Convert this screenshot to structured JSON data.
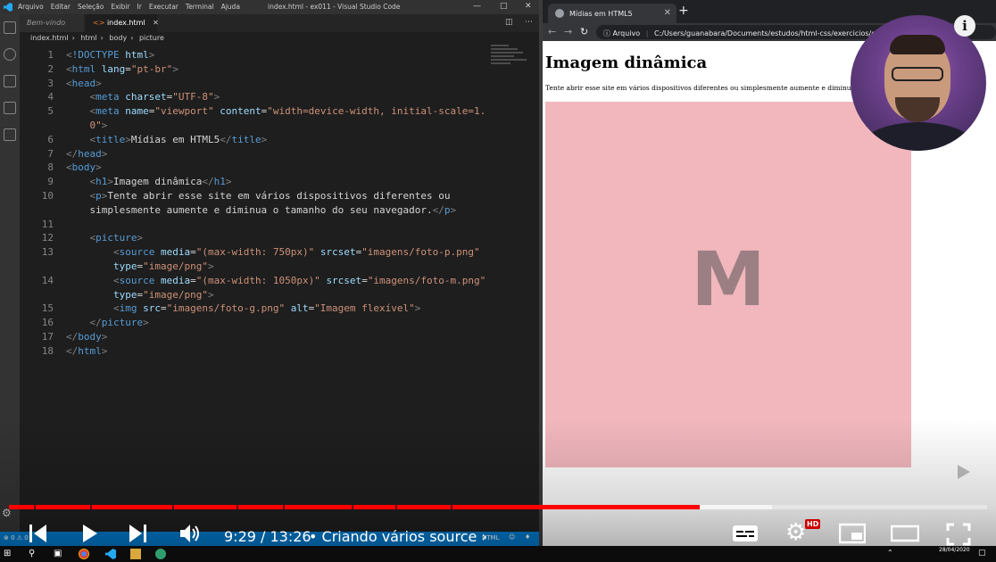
{
  "vscode": {
    "menu": [
      "Arquivo",
      "Editar",
      "Seleção",
      "Exibir",
      "Ir",
      "Executar",
      "Terminal",
      "Ajuda"
    ],
    "window_title": "index.html - ex011 - Visual Studio Code",
    "tabs": [
      {
        "label": "Bem-vindo"
      },
      {
        "label": "index.html"
      }
    ],
    "breadcrumb": [
      "index.html",
      "html",
      "body",
      "picture"
    ],
    "status_language": "HTML"
  },
  "code_lines": [
    {
      "n": "1",
      "html": "<span class='t-br'>&lt;</span><span class='t-tag'>!DOCTYPE</span> <span class='t-attr'>html</span><span class='t-br'>&gt;</span>"
    },
    {
      "n": "2",
      "html": "<span class='t-br'>&lt;</span><span class='t-tag'>html</span> <span class='t-attr'>lang</span>=<span class='t-str'>\"pt-br\"</span><span class='t-br'>&gt;</span>"
    },
    {
      "n": "3",
      "html": "<span class='t-br'>&lt;</span><span class='t-tag'>head</span><span class='t-br'>&gt;</span>"
    },
    {
      "n": "4",
      "html": "    <span class='t-br'>&lt;</span><span class='t-tag'>meta</span> <span class='t-attr'>charset</span>=<span class='t-str'>\"UTF-8\"</span><span class='t-br'>&gt;</span>"
    },
    {
      "n": "5",
      "html": "    <span class='t-br'>&lt;</span><span class='t-tag'>meta</span> <span class='t-attr'>name</span>=<span class='t-str'>\"viewport\"</span> <span class='t-attr'>content</span>=<span class='t-str'>\"width=device-width, initial-scale=1.</span>"
    },
    {
      "n": "",
      "html": "    <span class='t-str'>0\"</span><span class='t-br'>&gt;</span>"
    },
    {
      "n": "6",
      "html": "    <span class='t-br'>&lt;</span><span class='t-tag'>title</span><span class='t-br'>&gt;</span>Mídias em HTML5<span class='t-br'>&lt;/</span><span class='t-tag'>title</span><span class='t-br'>&gt;</span>"
    },
    {
      "n": "7",
      "html": "<span class='t-br'>&lt;/</span><span class='t-tag'>head</span><span class='t-br'>&gt;</span>"
    },
    {
      "n": "8",
      "html": "<span class='t-br'>&lt;</span><span class='t-tag'>body</span><span class='t-br'>&gt;</span>"
    },
    {
      "n": "9",
      "html": "    <span class='t-br'>&lt;</span><span class='t-tag'>h1</span><span class='t-br'>&gt;</span>Imagem dinâmica<span class='t-br'>&lt;/</span><span class='t-tag'>h1</span><span class='t-br'>&gt;</span>"
    },
    {
      "n": "10",
      "html": "    <span class='t-br'>&lt;</span><span class='t-tag'>p</span><span class='t-br'>&gt;</span>Tente abrir esse site em vários dispositivos diferentes ou"
    },
    {
      "n": "",
      "html": "    simplesmente aumente e diminua o tamanho do seu navegador.<span class='t-br'>&lt;/</span><span class='t-tag'>p</span><span class='t-br'>&gt;</span>"
    },
    {
      "n": "11",
      "html": ""
    },
    {
      "n": "12",
      "html": "    <span class='t-br'>&lt;</span><span class='t-tag'>picture</span><span class='t-br'>&gt;</span>"
    },
    {
      "n": "13",
      "html": "        <span class='t-br'>&lt;</span><span class='t-tag'>source</span> <span class='t-attr'>media</span>=<span class='t-str'>\"(max-width: 750px)\"</span> <span class='t-attr'>srcset</span>=<span class='t-str'>\"imagens/foto-p.png\"</span>"
    },
    {
      "n": "",
      "html": "        <span class='t-attr'>type</span>=<span class='t-str'>\"image/png\"</span><span class='t-br'>&gt;</span>"
    },
    {
      "n": "14",
      "html": "        <span class='t-br'>&lt;</span><span class='t-tag'>source</span> <span class='t-attr'>media</span>=<span class='t-str'>\"(max-width: 1050px)\"</span> <span class='t-attr'>srcset</span>=<span class='t-str'>\"imagens/foto-m.png\"</span>"
    },
    {
      "n": "",
      "html": "        <span class='t-attr'>type</span>=<span class='t-str'>\"image/png\"</span><span class='t-br'>&gt;</span>"
    },
    {
      "n": "15",
      "html": "        <span class='t-br'>&lt;</span><span class='t-tag'>img</span> <span class='t-attr'>src</span>=<span class='t-str'>\"imagens/foto-g.png\"</span> <span class='t-attr'>alt</span>=<span class='t-str'>\"Imagem flexível\"</span><span class='t-br'>&gt;</span>"
    },
    {
      "n": "16",
      "html": "    <span class='t-br'>&lt;/</span><span class='t-tag'>picture</span><span class='t-br'>&gt;</span>"
    },
    {
      "n": "17",
      "html": "<span class='t-br'>&lt;/</span><span class='t-tag'>body</span><span class='t-br'>&gt;</span>"
    },
    {
      "n": "18",
      "html": "<span class='t-br'>&lt;/</span><span class='t-tag'>html</span><span class='t-br'>&gt;</span>"
    }
  ],
  "chrome": {
    "tab_title": "Mídias em HTML5",
    "omnibox_label": "Arquivo",
    "url": "C:/Users/guanabara/Documents/estudos/html-css/exercicios/ex011/index.html"
  },
  "page": {
    "heading": "Imagem dinâmica",
    "paragraph": "Tente abrir esse site em vários dispositivos diferentes ou simplesmente aumente e diminua o tamanho do seu navegador.",
    "image_letter": "M",
    "image_color": "#f1b7bd"
  },
  "player": {
    "time": "9:29 / 13:26",
    "chapter": "Criando vários source",
    "progress_fraction": 0.706,
    "buffered_fraction": 0.78,
    "hd_badge": "HD",
    "accent_color": "#ff0000",
    "chapter_stops": [
      0.026,
      0.083,
      0.167,
      0.233,
      0.28,
      0.35,
      0.395,
      0.452
    ]
  },
  "taskbar": {
    "date": "28/04/2020"
  }
}
